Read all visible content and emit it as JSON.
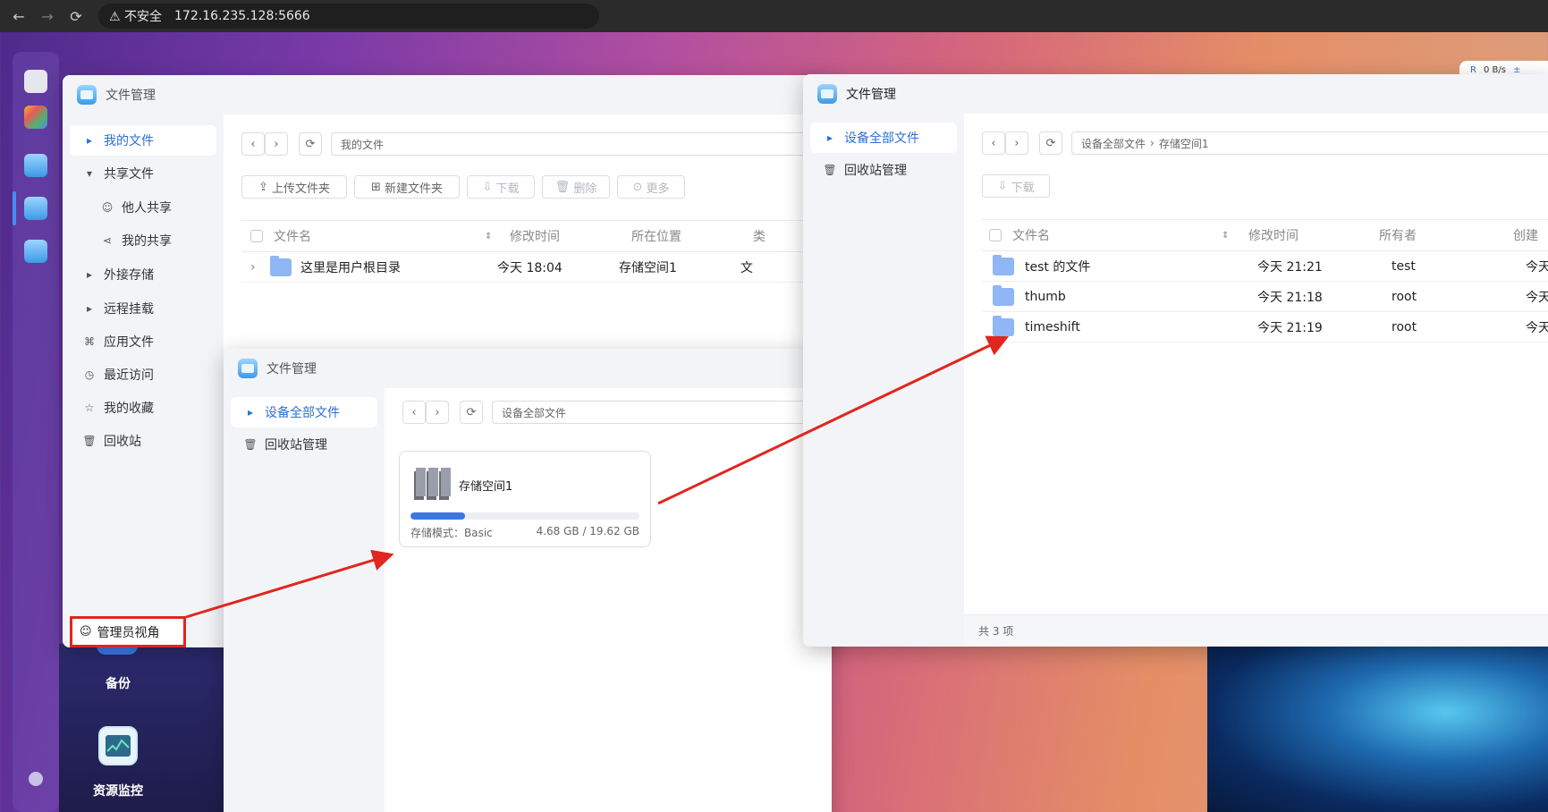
{
  "browser": {
    "url": "172.16.235.128:5666",
    "insecure_label": "不安全"
  },
  "speed": {
    "value": "0 B/s",
    "prefix": "R",
    "suffix": "±"
  },
  "desktop": {
    "backup_label": "备份",
    "monitor_label": "资源监控"
  },
  "win1": {
    "title": "文件管理",
    "sidebar": [
      {
        "label": "我的文件",
        "icon": "arrow-right-icon"
      },
      {
        "label": "共享文件",
        "icon": "arrow-down-icon"
      },
      {
        "label": "他人共享",
        "icon": "user-icon"
      },
      {
        "label": "我的共享",
        "icon": "share-icon"
      },
      {
        "label": "外接存储",
        "icon": "arrow-right-icon"
      },
      {
        "label": "远程挂载",
        "icon": "arrow-right-icon"
      },
      {
        "label": "应用文件",
        "icon": "apps-icon"
      },
      {
        "label": "最近访问",
        "icon": "clock-icon"
      },
      {
        "label": "我的收藏",
        "icon": "star-icon"
      },
      {
        "label": "回收站",
        "icon": "trash-icon"
      }
    ],
    "admin_view": "管理员视角",
    "path": "我的文件",
    "toolbar": {
      "upload": "上传文件夹",
      "newfolder": "新建文件夹",
      "download": "下载",
      "delete": "删除",
      "more": "更多"
    },
    "columns": {
      "name": "文件名",
      "mtime": "修改时间",
      "location": "所在位置",
      "type": "类"
    },
    "rows": [
      {
        "name": "这里是用户根目录",
        "mtime": "今天 18:04",
        "location": "存储空间1",
        "type": "文"
      }
    ]
  },
  "win2": {
    "title": "文件管理",
    "sidebar": [
      {
        "label": "设备全部文件"
      },
      {
        "label": "回收站管理"
      }
    ],
    "path": "设备全部文件",
    "storage": {
      "name": "存储空间1",
      "mode": "存储模式：Basic",
      "usage": "4.68 GB / 19.62 GB",
      "fraction": 0.24
    }
  },
  "win3": {
    "title": "文件管理",
    "sidebar": [
      {
        "label": "设备全部文件"
      },
      {
        "label": "回收站管理"
      }
    ],
    "path": {
      "root": "设备全部文件",
      "sep": "›",
      "current": "存储空间1"
    },
    "toolbar": {
      "download": "下载"
    },
    "columns": {
      "name": "文件名",
      "mtime": "修改时间",
      "owner": "所有者",
      "created": "创建"
    },
    "rows": [
      {
        "name": "test 的文件",
        "mtime": "今天 21:21",
        "owner": "test",
        "created": "今天"
      },
      {
        "name": "thumb",
        "mtime": "今天 21:18",
        "owner": "root",
        "created": "今天"
      },
      {
        "name": "timeshift",
        "mtime": "今天 21:19",
        "owner": "root",
        "created": "今天"
      }
    ],
    "footer": "共 3 项"
  }
}
